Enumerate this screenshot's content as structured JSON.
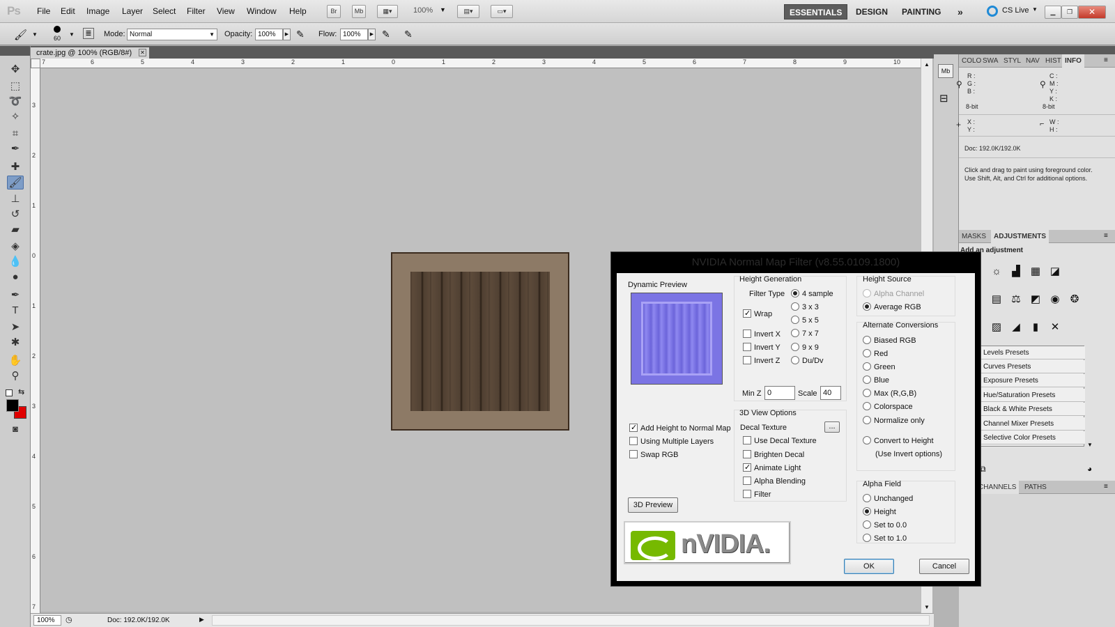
{
  "app": {
    "logo": "Ps"
  },
  "menu": [
    "File",
    "Edit",
    "Image",
    "Layer",
    "Select",
    "Filter",
    "View",
    "Window",
    "Help"
  ],
  "appbar": {
    "br": "Br",
    "mb": "Mb",
    "zoom": "100%"
  },
  "workspaces": [
    "ESSENTIALS",
    "DESIGN",
    "PAINTING"
  ],
  "cslive": "CS Live",
  "options": {
    "brush_size": "60",
    "mode_label": "Mode:",
    "mode_value": "Normal",
    "opacity_label": "Opacity:",
    "opacity_value": "100%",
    "flow_label": "Flow:",
    "flow_value": "100%"
  },
  "document": {
    "tab_title": "crate.jpg @ 100% (RGB/8#)",
    "zoom": "100%",
    "doc_size": "Doc: 192.0K/192.0K"
  },
  "ruler": {
    "h": [
      "7",
      "6",
      "5",
      "4",
      "3",
      "2",
      "1",
      "0",
      "1",
      "2",
      "3",
      "4",
      "5",
      "6",
      "7",
      "8",
      "9",
      "10"
    ],
    "v": [
      "3",
      "2",
      "1",
      "0",
      "1",
      "2",
      "3",
      "4",
      "5",
      "6",
      "7"
    ]
  },
  "info_panel": {
    "tabs": [
      "COLO",
      "SWA",
      "STYL",
      "NAV",
      "HIST",
      "INFO"
    ],
    "rgb": [
      "R :",
      "G :",
      "B :"
    ],
    "cmyk": [
      "C :",
      "M :",
      "Y :",
      "K :"
    ],
    "bit_left": "8-bit",
    "bit_right": "8-bit",
    "xy": [
      "X :",
      "Y :"
    ],
    "wh": [
      "W :",
      "H :"
    ],
    "doc": "Doc: 192.0K/192.0K",
    "hint": "Click and drag to paint using foreground color.  Use Shift, Alt, and Ctrl for additional options."
  },
  "adjust_panel": {
    "tabs": [
      "MASKS",
      "ADJUSTMENTS"
    ],
    "heading": "Add an adjustment",
    "presets": [
      "Levels Presets",
      "Curves Presets",
      "Exposure Presets",
      "Hue/Saturation Presets",
      "Black & White Presets",
      "Channel Mixer Presets",
      "Selective Color Presets"
    ]
  },
  "layers_panel": {
    "tabs": [
      "RS",
      "CHANNELS",
      "PATHS"
    ]
  },
  "dialog": {
    "title": "NVIDIA Normal Map Filter (v8.55.0109.1800)",
    "dynamic_preview": "Dynamic Preview",
    "height_generation": "Height Generation",
    "filter_type": "Filter Type",
    "filters": [
      "4 sample",
      "3 x 3",
      "5 x 5",
      "7 x 7",
      "9 x 9",
      "Du/Dv"
    ],
    "wrap": "Wrap",
    "invert": [
      "Invert X",
      "Invert Y",
      "Invert Z"
    ],
    "minz_label": "Min Z",
    "minz_value": "0",
    "scale_label": "Scale",
    "scale_value": "40",
    "height_source": "Height Source",
    "alpha_channel": "Alpha Channel",
    "average_rgb": "Average RGB",
    "alt_conversions": "Alternate Conversions",
    "conversions": [
      "Biased RGB",
      "Red",
      "Green",
      "Blue",
      "Max (R,G,B)",
      "Colorspace",
      "Normalize only"
    ],
    "convert_height": "Convert to Height",
    "use_invert": "(Use Invert options)",
    "left_checks": [
      "Add Height to Normal Map",
      "Using Multiple Layers",
      "Swap RGB"
    ],
    "view_options": "3D View Options",
    "decal_texture": "Decal Texture",
    "decal_btn": "...",
    "view_checks": [
      "Use Decal Texture",
      "Brighten Decal",
      "Animate Light",
      "Alpha Blending",
      "Filter"
    ],
    "preview_3d": "3D Preview",
    "alpha_field": "Alpha Field",
    "alpha_opts": [
      "Unchanged",
      "Height",
      "Set to 0.0",
      "Set to 1.0"
    ],
    "ok": "OK",
    "cancel": "Cancel",
    "logo_text": "nVIDIA."
  }
}
